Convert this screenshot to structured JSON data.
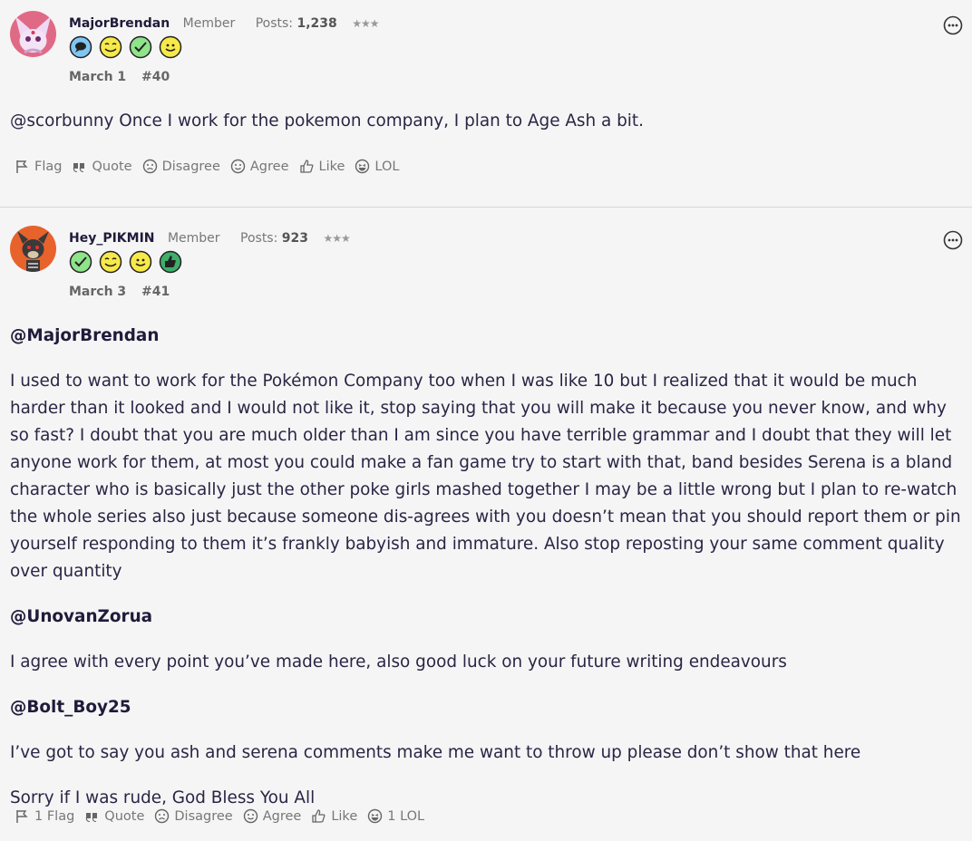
{
  "posts": [
    {
      "username": "MajorBrendan",
      "role": "Member",
      "posts_label": "Posts:",
      "posts_count": "1,238",
      "stars": "★★★",
      "badges": [
        "speech-bubble-badge",
        "wink-badge",
        "checkmark-badge",
        "smile-badge"
      ],
      "date": "March 1",
      "number": "#40",
      "paragraphs": [
        {
          "text": "@scorbunny Once I work for the pokemon company, I plan to Age Ash a bit."
        }
      ],
      "actions": {
        "flag": "Flag",
        "quote": "Quote",
        "disagree": "Disagree",
        "agree": "Agree",
        "like": "Like",
        "lol": "LOL"
      }
    },
    {
      "username": "Hey_PIKMIN",
      "role": "Member",
      "posts_label": "Posts:",
      "posts_count": "923",
      "stars": "★★★",
      "badges": [
        "checkmark-badge",
        "wink-badge",
        "smile-badge",
        "thumbs-up-badge"
      ],
      "date": "March 3",
      "number": "#41",
      "paragraphs": [
        {
          "mention": "@MajorBrendan"
        },
        {
          "text": "I used to want to work for the Pokémon Company too when I was like 10 but I realized that it would be much harder than it looked and I would not like it, stop saying that you will make it because you never know, and why so fast? I doubt that you are much older than I am since you have terrible grammar and I doubt that they will let anyone work for them, at most you could make a fan game try to start with that, band besides Serena is a bland character who is basically just the other poke girls mashed together I may be a little wrong but I plan to re-watch the whole series also just because someone dis-agrees with you doesn’t mean that you should report them or pin yourself responding to them it’s frankly babyish and immature. Also stop reposting your same comment quality over quantity"
        },
        {
          "mention": "@UnovanZorua"
        },
        {
          "text": "I agree with every point you’ve made here, also good luck on your future writing endeavours"
        },
        {
          "mention": "@Bolt_Boy25"
        },
        {
          "text": "I’ve got to say you ash and serena comments make me want to throw up please don’t show that here"
        },
        {
          "text": "Sorry if I was rude, God Bless You All"
        }
      ],
      "actions": {
        "flag": "1 Flag",
        "quote": "Quote",
        "disagree": "Disagree",
        "agree": "Agree",
        "like": "Like",
        "lol": "1 LOL"
      }
    }
  ]
}
